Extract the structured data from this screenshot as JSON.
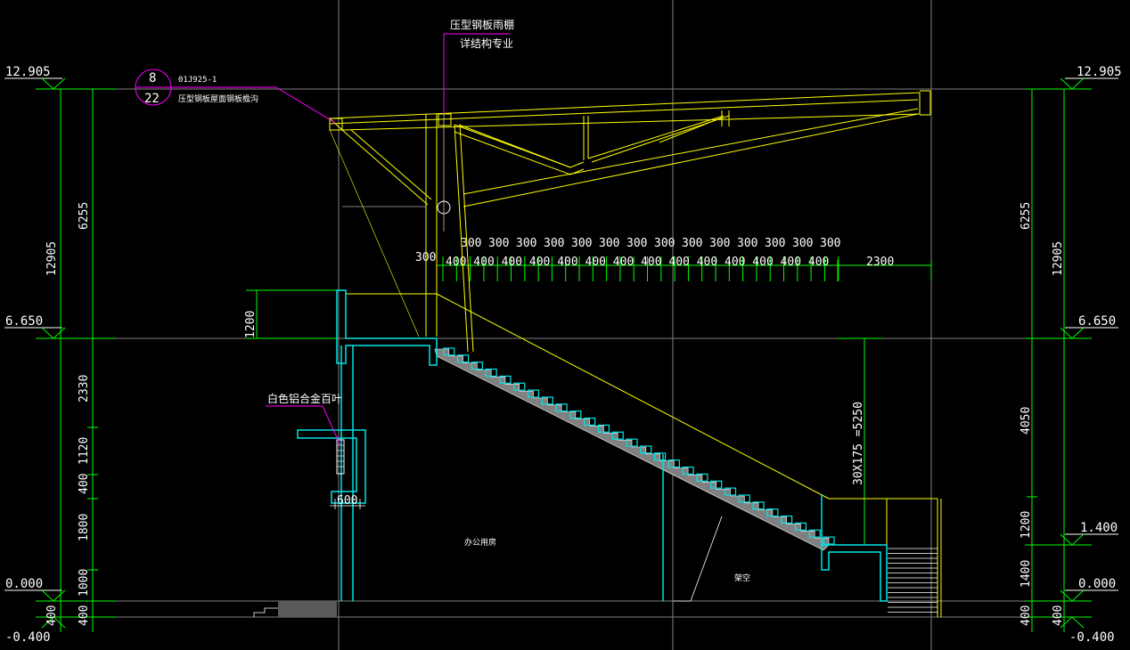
{
  "canvas": {
    "background": "#000000"
  },
  "colors": {
    "dimension": "#00ff00",
    "structure": "#ffff00",
    "section": "#00e5e5",
    "leader": "#ff00ff",
    "grid": "#7f7f7f",
    "text": "#ffffff",
    "stair_fill": "#808080"
  },
  "levels": {
    "left": [
      "12.905",
      "6.650",
      "0.000",
      "-0.400"
    ],
    "right": [
      "12.905",
      "6.650",
      "1.400",
      "0.000",
      "-0.400"
    ]
  },
  "left_dims": {
    "outer_total": "12905",
    "inner": [
      "6255",
      "2330",
      "1120",
      "400",
      "1800",
      "1000",
      "400"
    ],
    "parapet": "1200",
    "ground": "400"
  },
  "right_dims": {
    "outer_total": "12905",
    "inner": [
      "6255",
      "4050",
      "1200",
      "1400",
      "400"
    ],
    "ground": "400",
    "stair_height": "30X175 =5250"
  },
  "tread_dims": {
    "top_row": [
      "300",
      "300",
      "300",
      "300",
      "300",
      "300",
      "300",
      "300",
      "300",
      "300",
      "300",
      "300",
      "300",
      "300"
    ],
    "bottom_row": [
      "400",
      "400",
      "400",
      "400",
      "400",
      "400",
      "400",
      "400",
      "400",
      "400",
      "400",
      "400",
      "400",
      "400"
    ],
    "first": "300",
    "last": "2300"
  },
  "callout": {
    "top_number": "8",
    "bottom_number": "22",
    "ref_code": "01J925-1",
    "ref_desc": "压型钢板屋面钢板檐沟"
  },
  "canopy_note": {
    "line1": "压型钢板雨棚",
    "line2": "详结构专业"
  },
  "louver_note": "白色铝合金百叶",
  "louver_dim": "600",
  "room_labels": {
    "office": "办公用房",
    "void": "架空"
  }
}
